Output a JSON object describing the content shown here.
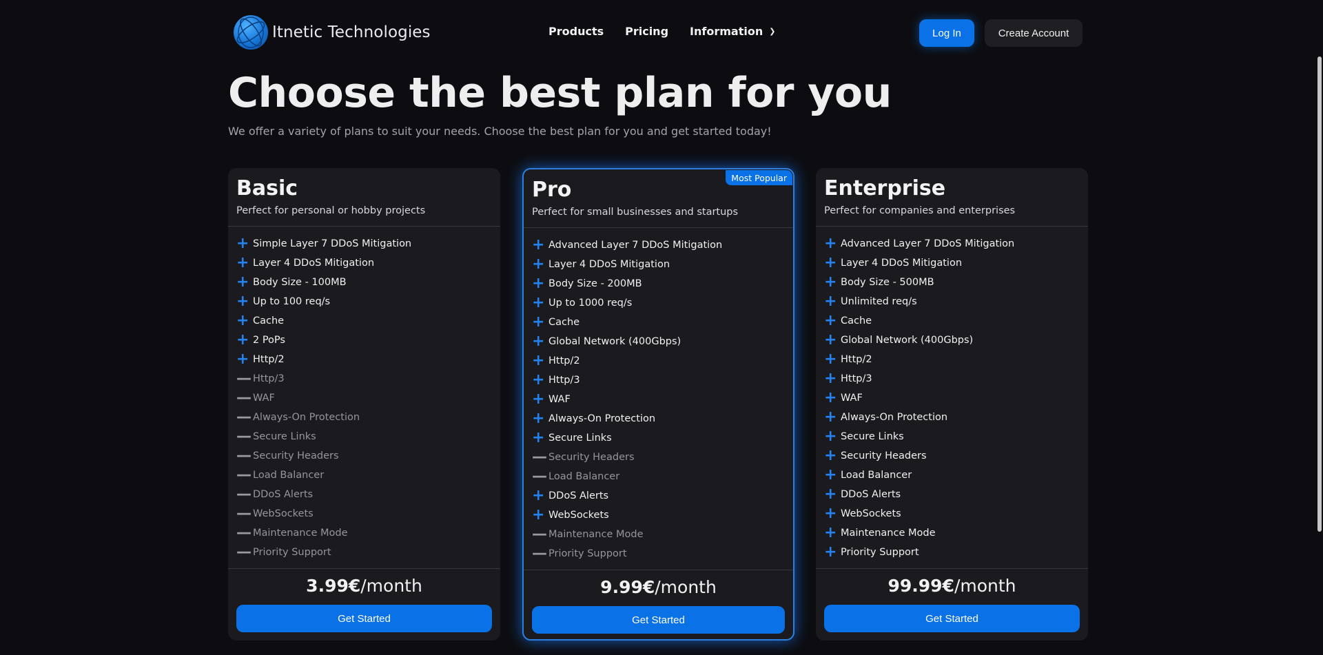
{
  "brand": {
    "name": "Itnetic Technologies"
  },
  "nav": {
    "links": [
      "Products",
      "Pricing",
      "Information"
    ],
    "login": "Log In",
    "create_account": "Create Account"
  },
  "hero": {
    "title": "Choose the best plan for you",
    "subtitle": "We offer a variety of plans to suit your needs. Choose the best plan for you and get started today!"
  },
  "colors": {
    "accent": "#0a72e6",
    "background": "#0d0d11",
    "card": "#1b1b1f",
    "included_icon": "#2682ef",
    "excluded_icon": "#9a9aa0"
  },
  "plans": [
    {
      "name": "Basic",
      "description": "Perfect for personal or hobby projects",
      "price_amount": "3.99€",
      "price_unit": "/month",
      "cta": "Get Started",
      "badge": "",
      "features": [
        {
          "label": "Simple Layer 7 DDoS Mitigation",
          "included": true
        },
        {
          "label": "Layer 4 DDoS Mitigation",
          "included": true
        },
        {
          "label": "Body Size - 100MB",
          "included": true
        },
        {
          "label": "Up to 100 req/s",
          "included": true
        },
        {
          "label": "Cache",
          "included": true
        },
        {
          "label": "2 PoPs",
          "included": true
        },
        {
          "label": "Http/2",
          "included": true
        },
        {
          "label": "Http/3",
          "included": false
        },
        {
          "label": "WAF",
          "included": false
        },
        {
          "label": "Always-On Protection",
          "included": false
        },
        {
          "label": "Secure Links",
          "included": false
        },
        {
          "label": "Security Headers",
          "included": false
        },
        {
          "label": "Load Balancer",
          "included": false
        },
        {
          "label": "DDoS Alerts",
          "included": false
        },
        {
          "label": "WebSockets",
          "included": false
        },
        {
          "label": "Maintenance Mode",
          "included": false
        },
        {
          "label": "Priority Support",
          "included": false
        }
      ]
    },
    {
      "name": "Pro",
      "description": "Perfect for small businesses and startups",
      "price_amount": "9.99€",
      "price_unit": "/month",
      "cta": "Get Started",
      "badge": "Most Popular",
      "features": [
        {
          "label": "Advanced Layer 7 DDoS Mitigation",
          "included": true
        },
        {
          "label": "Layer 4 DDoS Mitigation",
          "included": true
        },
        {
          "label": "Body Size - 200MB",
          "included": true
        },
        {
          "label": "Up to 1000 req/s",
          "included": true
        },
        {
          "label": "Cache",
          "included": true
        },
        {
          "label": "Global Network (400Gbps)",
          "included": true
        },
        {
          "label": "Http/2",
          "included": true
        },
        {
          "label": "Http/3",
          "included": true
        },
        {
          "label": "WAF",
          "included": true
        },
        {
          "label": "Always-On Protection",
          "included": true
        },
        {
          "label": "Secure Links",
          "included": true
        },
        {
          "label": "Security Headers",
          "included": false
        },
        {
          "label": "Load Balancer",
          "included": false
        },
        {
          "label": "DDoS Alerts",
          "included": true
        },
        {
          "label": "WebSockets",
          "included": true
        },
        {
          "label": "Maintenance Mode",
          "included": false
        },
        {
          "label": "Priority Support",
          "included": false
        }
      ]
    },
    {
      "name": "Enterprise",
      "description": "Perfect for companies and enterprises",
      "price_amount": "99.99€",
      "price_unit": "/month",
      "cta": "Get Started",
      "badge": "",
      "features": [
        {
          "label": "Advanced Layer 7 DDoS Mitigation",
          "included": true
        },
        {
          "label": "Layer 4 DDoS Mitigation",
          "included": true
        },
        {
          "label": "Body Size - 500MB",
          "included": true
        },
        {
          "label": "Unlimited req/s",
          "included": true
        },
        {
          "label": "Cache",
          "included": true
        },
        {
          "label": "Global Network (400Gbps)",
          "included": true
        },
        {
          "label": "Http/2",
          "included": true
        },
        {
          "label": "Http/3",
          "included": true
        },
        {
          "label": "WAF",
          "included": true
        },
        {
          "label": "Always-On Protection",
          "included": true
        },
        {
          "label": "Secure Links",
          "included": true
        },
        {
          "label": "Security Headers",
          "included": true
        },
        {
          "label": "Load Balancer",
          "included": true
        },
        {
          "label": "DDoS Alerts",
          "included": true
        },
        {
          "label": "WebSockets",
          "included": true
        },
        {
          "label": "Maintenance Mode",
          "included": true
        },
        {
          "label": "Priority Support",
          "included": true
        }
      ]
    }
  ]
}
